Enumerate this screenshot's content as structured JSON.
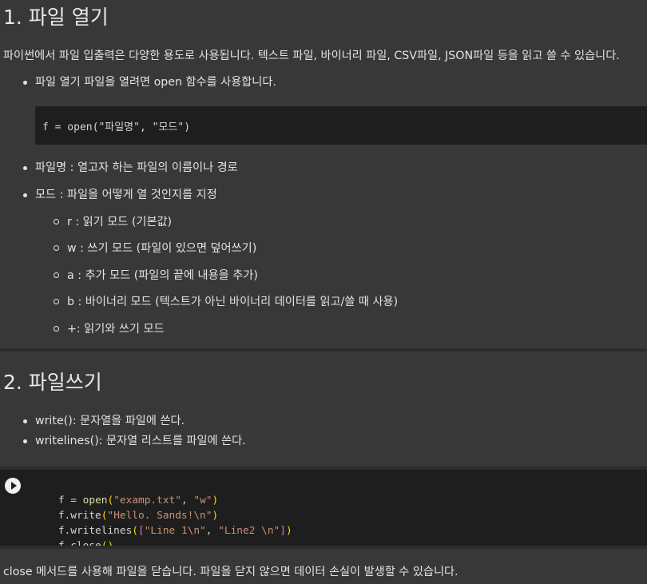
{
  "section1": {
    "heading": "1. 파일 열기",
    "intro": "파이썬에서 파일 입출력은 다양한 용도로 사용됩니다. 텍스트 파일, 바이너리 파일, CSV파일, JSON파일 등을 읽고 쓸 수 있습니다.",
    "bullet_open": "파일 열기 파일을 열려면 open 함수를 사용합니다.",
    "code_example": "f = open(\"파일명\", \"모드\")",
    "bullet_filename": "파일명 : 열고자 하는 파일의 이름이나 경로",
    "bullet_mode": "모드 : 파일을 어떻게 열 것인지를 지정",
    "modes": [
      "r : 읽기 모드 (기본값)",
      "w : 쓰기 모드 (파일이 있으면 덮어쓰기)",
      "a : 추가 모드 (파일의 끝에 내용을 추가)",
      "b : 바이너리 모드 (텍스트가 아닌 바이너리 데이터를 읽고/쓸 때 사용)",
      "+: 읽기와 쓰기 모드"
    ]
  },
  "section2": {
    "heading": "2. 파일쓰기",
    "bullets": [
      "write(): 문자열을 파일에 쓴다.",
      "writelines(): 문자열 리스트를 파일에 쓴다."
    ]
  },
  "code_cell": {
    "tokens": [
      [
        "f = ",
        "open",
        "(",
        "\"examp.txt\"",
        ", ",
        "\"w\"",
        ")"
      ],
      [
        "f.write",
        "(",
        "\"Hello. Sands!\\n\"",
        ")"
      ],
      [
        "f.writelines",
        "(",
        "[",
        "\"Line 1\\n\"",
        ", ",
        "\"Line2 \\n\"",
        "]",
        ")"
      ],
      [
        "f.close",
        "(",
        ")"
      ]
    ]
  },
  "footer_text": "close 메서드를 사용해 파일을 닫습니다. 파일을 닫지 않으면 데이터 손실이 발생할 수 있습니다."
}
